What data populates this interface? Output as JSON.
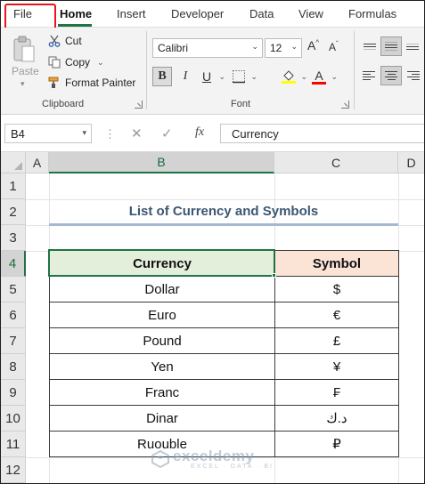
{
  "ribbon_tabs": [
    {
      "label": "File"
    },
    {
      "label": "Home"
    },
    {
      "label": "Insert"
    },
    {
      "label": "Developer"
    },
    {
      "label": "Data"
    },
    {
      "label": "View"
    },
    {
      "label": "Formulas"
    }
  ],
  "active_tab": "Home",
  "clipboard": {
    "paste_label": "Paste",
    "cut_label": "Cut",
    "copy_label": "Copy",
    "format_painter_label": "Format Painter",
    "group_label": "Clipboard"
  },
  "font": {
    "font_name": "Calibri",
    "font_size": "12",
    "grow_label": "A",
    "shrink_label": "A",
    "bold_label": "B",
    "italic_label": "I",
    "underline_label": "U",
    "color_label": "A",
    "group_label": "Font",
    "fill_color": "#ffff00",
    "font_color": "#ff0000"
  },
  "formula_bar": {
    "name_box": "B4",
    "fx_label": "fx",
    "formula": "Currency"
  },
  "columns": [
    "A",
    "B",
    "C",
    "D"
  ],
  "rows": [
    "1",
    "2",
    "3",
    "4",
    "5",
    "6",
    "7",
    "8",
    "9",
    "10",
    "11",
    "12"
  ],
  "selected_column": "B",
  "selected_row": "4",
  "sheet": {
    "title": "List of Currency and Symbols",
    "headers": {
      "currency": "Currency",
      "symbol": "Symbol"
    },
    "rows": [
      {
        "currency": "Dollar",
        "symbol": "$"
      },
      {
        "currency": "Euro",
        "symbol": "€"
      },
      {
        "currency": "Pound",
        "symbol": "£"
      },
      {
        "currency": "Yen",
        "symbol": "¥"
      },
      {
        "currency": "Franc",
        "symbol": "₣"
      },
      {
        "currency": "Dinar",
        "symbol": "د.ك"
      },
      {
        "currency": "Ruouble",
        "symbol": "₽"
      }
    ]
  },
  "watermark": {
    "name": "exceldemy",
    "tagline": "EXCEL · DATA · BI"
  },
  "colors": {
    "accent_green": "#217346",
    "header_currency_fill": "#e3efdb",
    "header_symbol_fill": "#fbe3d6",
    "title_color": "#3b5772",
    "file_highlight": "#e8141b"
  }
}
